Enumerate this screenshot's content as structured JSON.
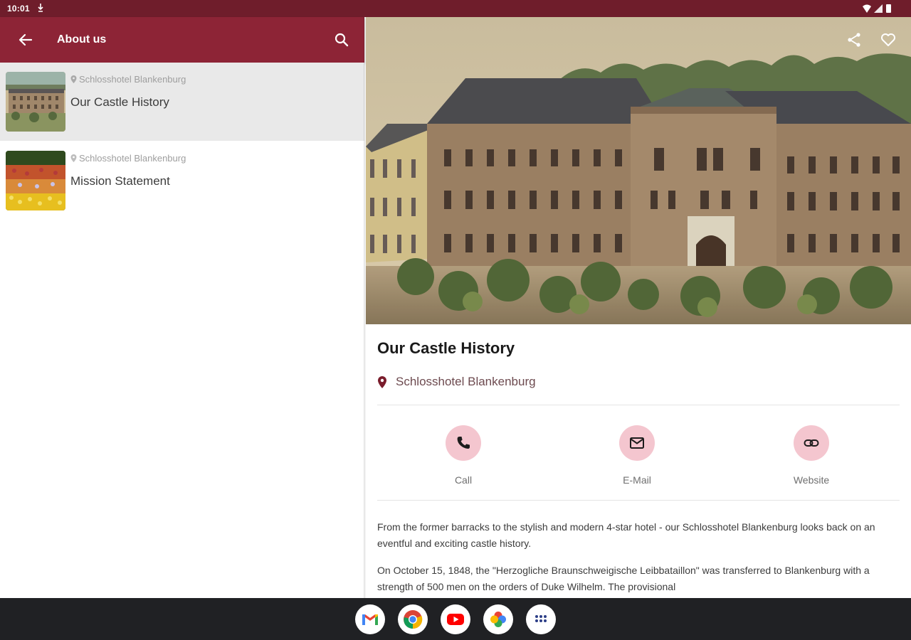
{
  "status_bar": {
    "time": "10:01"
  },
  "left": {
    "app_bar": {
      "title": "About us"
    },
    "items": [
      {
        "location": "Schlosshotel Blankenburg",
        "title": "Our Castle History",
        "selected": true
      },
      {
        "location": "Schlosshotel Blankenburg",
        "title": "Mission Statement",
        "selected": false
      }
    ]
  },
  "detail": {
    "title": "Our Castle History",
    "location": "Schlosshotel Blankenburg",
    "actions": {
      "call": "Call",
      "email": "E-Mail",
      "website": "Website"
    },
    "paragraphs": [
      "From the former barracks to the stylish and modern 4-star hotel - our Schlosshotel Blankenburg looks back on an eventful and exciting castle history.",
      "On October 15, 1848, the \"Herzogliche Braunschweigische Leibbataillon\" was transferred to Blankenburg with a strength of 500 men on the orders of Duke Wilhelm. The provisional"
    ]
  },
  "colors": {
    "status_bar": "#6f1d2b",
    "app_bar": "#8d2436",
    "accent_light": "#f4c6cf",
    "nav_bar": "#202124"
  },
  "icons": {
    "app_bar": [
      "arrow-back-icon",
      "search-icon"
    ],
    "hero": [
      "share-icon",
      "heart-icon"
    ],
    "actions": [
      "phone-icon",
      "mail-icon",
      "link-icon"
    ],
    "dock": [
      "gmail-icon",
      "chrome-icon",
      "youtube-icon",
      "photos-icon",
      "apps-icon"
    ]
  }
}
